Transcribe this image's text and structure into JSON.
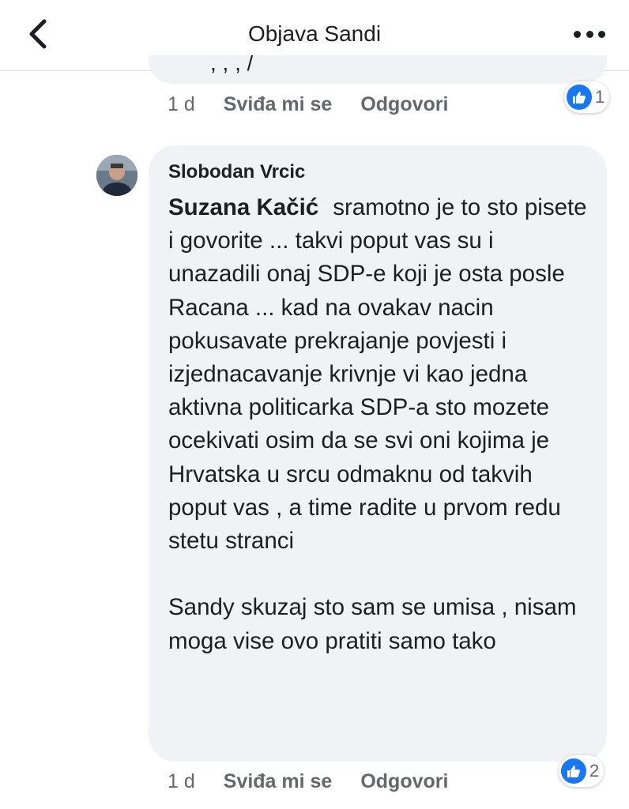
{
  "header": {
    "title": "Objava Sandi",
    "back_icon": "chevron-left-icon",
    "more_icon": "more-dots-icon"
  },
  "previous_comment": {
    "fragment": ", , , /",
    "time": "1 d",
    "like_label": "Sviđa mi se",
    "reply_label": "Odgovori",
    "reaction_icon": "like-icon",
    "reaction_count": "1"
  },
  "comment": {
    "author": "Slobodan Vrcic",
    "mention": "Suzana Kačić",
    "text": "sramotno je to sto pisete i govorite ... takvi poput vas su i unazadili onaj SDP-e  koji je osta posle Racana ... kad na ovakav nacin pokusavate prekrajanje povjesti i izjednacavanje krivnje vi kao jedna aktivna politicarka SDP-a sto mozete ocekivati osim da se svi oni kojima je Hrvatska u srcu odmaknu od takvih poput vas , a time radite u prvom redu stetu stranci",
    "text2": "Sandy skuzaj sto sam se umisa , nisam moga vise ovo pratiti samo tako",
    "time": "1 d",
    "like_label": "Sviđa mi se",
    "reply_label": "Odgovori",
    "reaction_icon": "like-icon",
    "reaction_count": "2"
  },
  "colors": {
    "bubble_bg": "#f0f2f5",
    "like_blue": "#1877f2",
    "meta_gray": "#65676b",
    "text": "#1c1e21"
  }
}
